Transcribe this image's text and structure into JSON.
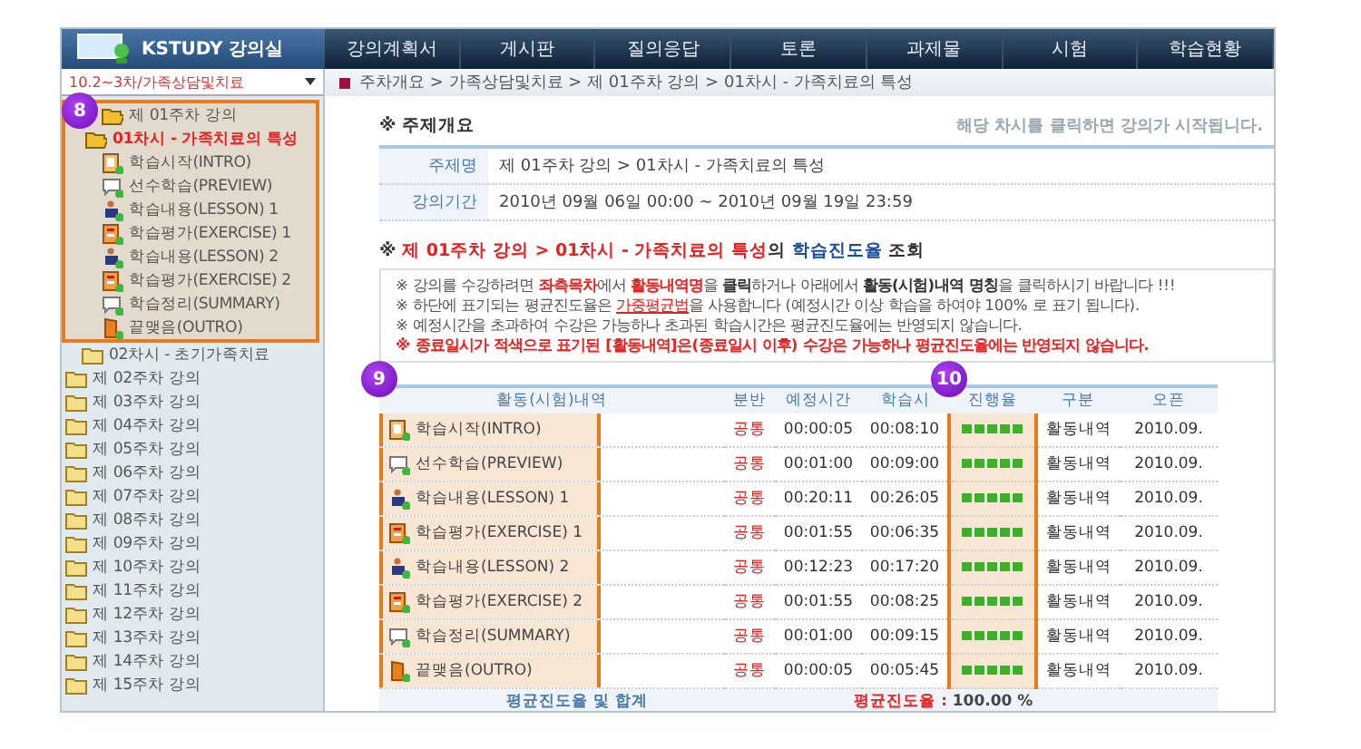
{
  "header": {
    "logo": "KSTUDY 강의실",
    "nav": [
      {
        "label": "강의계획서"
      },
      {
        "label": "게시판"
      },
      {
        "label": "질의응답"
      },
      {
        "label": "토론"
      },
      {
        "label": "과제물"
      },
      {
        "label": "시험"
      },
      {
        "label": "학습현황"
      }
    ],
    "overlay_notice": "해당 차시를 클릭하면 강의가 시작됩니다."
  },
  "sidebar": {
    "course_select": "10.2~3차/가족상담및치료",
    "callout": "8",
    "tree": [
      {
        "label": "제 01주차 강의",
        "expanded": true,
        "children": [
          {
            "label": "01차시 - 가족치료의 특성",
            "expanded": true,
            "selected": true,
            "children": [
              {
                "label": "학습시작(INTRO)",
                "kind": "intro"
              },
              {
                "label": "선수학습(PREVIEW)",
                "kind": "chat"
              },
              {
                "label": "학습내용(LESSON) 1",
                "kind": "lesson"
              },
              {
                "label": "학습평가(EXERCISE) 1",
                "kind": "exercise"
              },
              {
                "label": "학습내용(LESSON) 2",
                "kind": "lesson"
              },
              {
                "label": "학습평가(EXERCISE) 2",
                "kind": "exercise"
              },
              {
                "label": "학습정리(SUMMARY)",
                "kind": "chat"
              },
              {
                "label": "끝맺음(OUTRO)",
                "kind": "outro"
              }
            ]
          },
          {
            "label": "02차시 - 초기가족치료",
            "expanded": false,
            "selected": false
          }
        ]
      },
      {
        "label": "제 02주차 강의",
        "expanded": false
      },
      {
        "label": "제 03주차 강의",
        "expanded": false
      },
      {
        "label": "제 04주차 강의",
        "expanded": false
      },
      {
        "label": "제 05주차 강의",
        "expanded": false
      },
      {
        "label": "제 06주차 강의",
        "expanded": false
      },
      {
        "label": "제 07주차 강의",
        "expanded": false
      },
      {
        "label": "제 08주차 강의",
        "expanded": false
      },
      {
        "label": "제 09주차 강의",
        "expanded": false
      },
      {
        "label": "제 10주차 강의",
        "expanded": false
      },
      {
        "label": "제 11주차 강의",
        "expanded": false
      },
      {
        "label": "제 12주차 강의",
        "expanded": false
      },
      {
        "label": "제 13주차 강의",
        "expanded": false
      },
      {
        "label": "제 14주차 강의",
        "expanded": false
      },
      {
        "label": "제 15주차 강의",
        "expanded": false
      }
    ]
  },
  "breadcrumb": "주차개요 > 가족상담및치료 > 제 01주차 강의 > 01차시 - 가족치료의 특성",
  "overview": {
    "title": "※ 주제개요",
    "rows": [
      {
        "label": "주제명",
        "value": "제 01주차 강의 > 01차시 - 가족치료의 특성"
      },
      {
        "label": "강의기간",
        "value": "2010년 09월 06일 00:00 ~ 2010년 09월 19일 23:59"
      }
    ]
  },
  "progress_heading": {
    "prefix": "※ ",
    "lesson": "제 01주차 강의 > 01차시 - 가족치료의 특성",
    "connector": "의 ",
    "metric": "학습진도율",
    "suffix": " 조회"
  },
  "notices": [
    {
      "kind": "normal",
      "parts": [
        {
          "text": "※ 강의를 수강하려면 ",
          "kind": "text"
        },
        {
          "text": "좌측목차",
          "kind": "highlight"
        },
        {
          "text": "에서 ",
          "kind": "text"
        },
        {
          "text": "활동내역명",
          "kind": "highlight"
        },
        {
          "text": "을 ",
          "kind": "text"
        },
        {
          "text": "클릭",
          "kind": "emphasis"
        },
        {
          "text": "하거나 아래에서 ",
          "kind": "text"
        },
        {
          "text": "활동(시험)내역 명칭",
          "kind": "emphasis"
        },
        {
          "text": "을 클릭하시기 바랍니다 !!!",
          "kind": "text"
        }
      ]
    },
    {
      "kind": "normal",
      "parts": [
        {
          "text": "※ 하단에 표기되는 평균진도율은 ",
          "kind": "text"
        },
        {
          "text": "가중평균법",
          "kind": "link"
        },
        {
          "text": "을 사용합니다 (예정시간 이상 학습을 하여야 100% 로 표기 됩니다).",
          "kind": "text"
        }
      ]
    },
    {
      "kind": "normal",
      "parts": [
        {
          "text": "※ 예정시간을 초과하여 수강은 가능하나 초과된 학습시간은 평균진도율에는 반영되지 않습니다.",
          "kind": "text"
        }
      ]
    },
    {
      "kind": "warning",
      "parts": [
        {
          "text": "※ 종료일시가 적색으로 표기된 [활동내역]은(종료일시 이후) 수강은 가능하나 평균진도율에는 반영되지 않습니다.",
          "kind": "text"
        }
      ]
    }
  ],
  "table": {
    "columns": [
      "활동(시험)내역",
      "분반",
      "예정시간",
      "학습시",
      "진행율",
      "구분",
      "오픈"
    ],
    "callouts": [
      "9",
      "10"
    ],
    "rows": [
      {
        "activity": "학습시작(INTRO)",
        "kind": "intro",
        "section": "공통",
        "planned": "00:00:05",
        "studied": "00:08:10",
        "level": 1,
        "type": "활동내역",
        "open": "2010.09."
      },
      {
        "activity": "선수학습(PREVIEW)",
        "kind": "chat",
        "section": "공통",
        "planned": "00:01:00",
        "studied": "00:09:00",
        "level": 1,
        "type": "활동내역",
        "open": "2010.09."
      },
      {
        "activity": "학습내용(LESSON) 1",
        "kind": "lesson",
        "section": "공통",
        "planned": "00:20:11",
        "studied": "00:26:05",
        "level": 1,
        "type": "활동내역",
        "open": "2010.09."
      },
      {
        "activity": "학습평가(EXERCISE) 1",
        "kind": "exercise",
        "section": "공통",
        "planned": "00:01:55",
        "studied": "00:06:35",
        "level": 1,
        "type": "활동내역",
        "open": "2010.09."
      },
      {
        "activity": "학습내용(LESSON) 2",
        "kind": "lesson",
        "section": "공통",
        "planned": "00:12:23",
        "studied": "00:17:20",
        "level": 1,
        "type": "활동내역",
        "open": "2010.09."
      },
      {
        "activity": "학습평가(EXERCISE) 2",
        "kind": "exercise",
        "section": "공통",
        "planned": "00:01:55",
        "studied": "00:08:25",
        "level": 1,
        "type": "활동내역",
        "open": "2010.09."
      },
      {
        "activity": "학습정리(SUMMARY)",
        "kind": "chat",
        "section": "공통",
        "planned": "00:01:00",
        "studied": "00:09:15",
        "level": 1,
        "type": "활동내역",
        "open": "2010.09."
      },
      {
        "activity": "끝맺음(OUTRO)",
        "kind": "outro",
        "section": "공통",
        "planned": "00:00:05",
        "studied": "00:05:45",
        "level": 1,
        "type": "활동내역",
        "open": "2010.09."
      }
    ],
    "footer_label": "평균진도율 및 합계",
    "footer_avg_label": "평균진도율 :",
    "footer_avg_value": "100.00 %"
  }
}
